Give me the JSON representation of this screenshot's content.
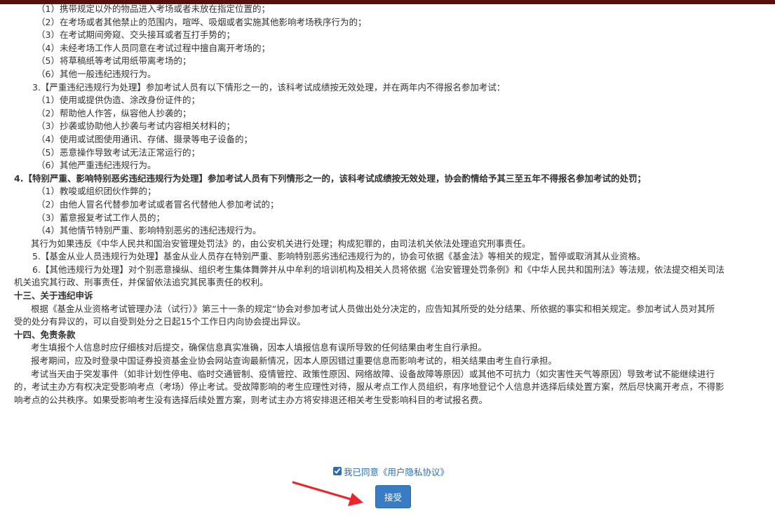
{
  "document": {
    "lines": [
      {
        "text": "（1）携带规定以外的物品进入考场或者未放在指定位置的；",
        "style": "i1"
      },
      {
        "text": "（2）在考场或者其他禁止的范围内，喧哗、吸烟或者实施其他影响考场秩序行为的；",
        "style": "i1"
      },
      {
        "text": "（3）在考试期间旁窥、交头接耳或者互打手势的；",
        "style": "i1"
      },
      {
        "text": "（4）未经考场工作人员同意在考试过程中擅自离开考场的；",
        "style": "i1"
      },
      {
        "text": "（5）将草稿纸等考试用纸带离考场的；",
        "style": "i1"
      },
      {
        "text": "（6）其他一般违纪违规行为。",
        "style": "i1"
      },
      {
        "text": "3.【严重违纪违规行为处理】参加考试人员有以下情形之一的，该科考试成绩按无效处理，并在两年内不得报名参加考试：",
        "style": "i2"
      },
      {
        "text": "（1）使用或提供伪造、涂改身份证件的；",
        "style": "i1"
      },
      {
        "text": "（2）帮助他人作答，纵容他人抄袭的；",
        "style": "i1"
      },
      {
        "text": "（3）抄袭或协助他人抄袭与考试内容相关材料的；",
        "style": "i1"
      },
      {
        "text": "（4）使用或试图使用通讯、存储、摄录等电子设备的；",
        "style": "i1"
      },
      {
        "text": "（5）恶意操作导致考试无法正常运行的；",
        "style": "i1"
      },
      {
        "text": "（6）其他严重违纪违规行为。",
        "style": "i1"
      },
      {
        "text": "4.【特别严重、影响特别恶劣违纪违规行为处理】参加考试人员有下列情形之一的，该科考试成绩按无效处理，协会酌情给予其三至五年不得报名参加考试的处罚；",
        "style": "b"
      },
      {
        "text": "（1）教唆或组织团伙作弊的；",
        "style": "i1"
      },
      {
        "text": "（2）由他人冒名代替参加考试或者冒名代替他人参加考试的；",
        "style": "i1"
      },
      {
        "text": "（3）蓄意报复考试工作人员的；",
        "style": "i1"
      },
      {
        "text": "（4）其他情节特别严重、影响特别恶劣的违纪违规行为。",
        "style": "i1"
      },
      {
        "text": "其行为如果违反《中华人民共和国治安管理处罚法》的，由公安机关进行处理；构成犯罪的，由司法机关依法处理追究刑事责任。",
        "style": "i3"
      },
      {
        "text": "5.【基金从业人员违规行为处理】基金从业人员存在特别严重、影响特别恶劣违纪违规行为的，协会可依据《基金法》等相关的规定，暂停或取消其从业资格。",
        "style": "i2"
      },
      {
        "text": "6.【其他违规行为处理】对个别恶意操纵、组织考生集体舞弊并从中牟利的培训机构及相关人员将依据《治安管理处罚条例》和《中华人民共和国刑法》等法规，依法提交相关司法",
        "style": "i2"
      },
      {
        "text": "机关追究其行政、刑事责任，并保留依法追究其民事责任的权利。",
        "style": ""
      },
      {
        "text": "十三、关于违纪申诉",
        "style": "b"
      },
      {
        "text": "根据《基金从业资格考试管理办法（试行）》第三十一条的规定“协会对参加考试人员做出处分决定的，应告知其所受的处分结果、所依据的事实和相关规定。参加考试人员对其所",
        "style": "i3"
      },
      {
        "text": "受的处分有异议的，可以自受到处分之日起15个工作日内向协会提出异议。",
        "style": ""
      },
      {
        "text": "十四、免责条款",
        "style": "b"
      },
      {
        "text": "考生填报个人信息时应仔细核对后提交，确保信息真实准确，因本人填报信息有误所导致的任何结果由考生自行承担。",
        "style": "i3"
      },
      {
        "text": "报考期间，应及时登录中国证券投资基金业协会网站查询最新情况，因本人原因错过重要信息而影响考试的，相关结果由考生自行承担。",
        "style": "i3"
      },
      {
        "text": "考试当天由于突发事件（如非计划性停电、临时交通管制、疫情管控、政策性原因、网络故障、设备故障等原因）或其他不可抗力（如灾害性天气等原因）导致考试不能继续进行",
        "style": "i3"
      },
      {
        "text": "的，考试主办方有权决定受影响考点（考场）停止考试。受故障影响的考生应理性对待，服从考点工作人员组织，有序地登记个人信息并选择后续处置方案，然后尽快离开考点，不得影",
        "style": ""
      },
      {
        "text": "响考点的公共秩序。如果受影响考生没有选择后续处置方案，则考试主办方将安排退还相关考生受影响科目的考试报名费。",
        "style": ""
      }
    ]
  },
  "agreement": {
    "label": "我已同意《用户隐私协议》",
    "checked": true
  },
  "accept_button": {
    "label": "接受"
  },
  "colors": {
    "top_bar": "#5a0f0f",
    "link": "#2b6cb0",
    "button": "#3a7cc4",
    "arrow": "#e8262b"
  }
}
